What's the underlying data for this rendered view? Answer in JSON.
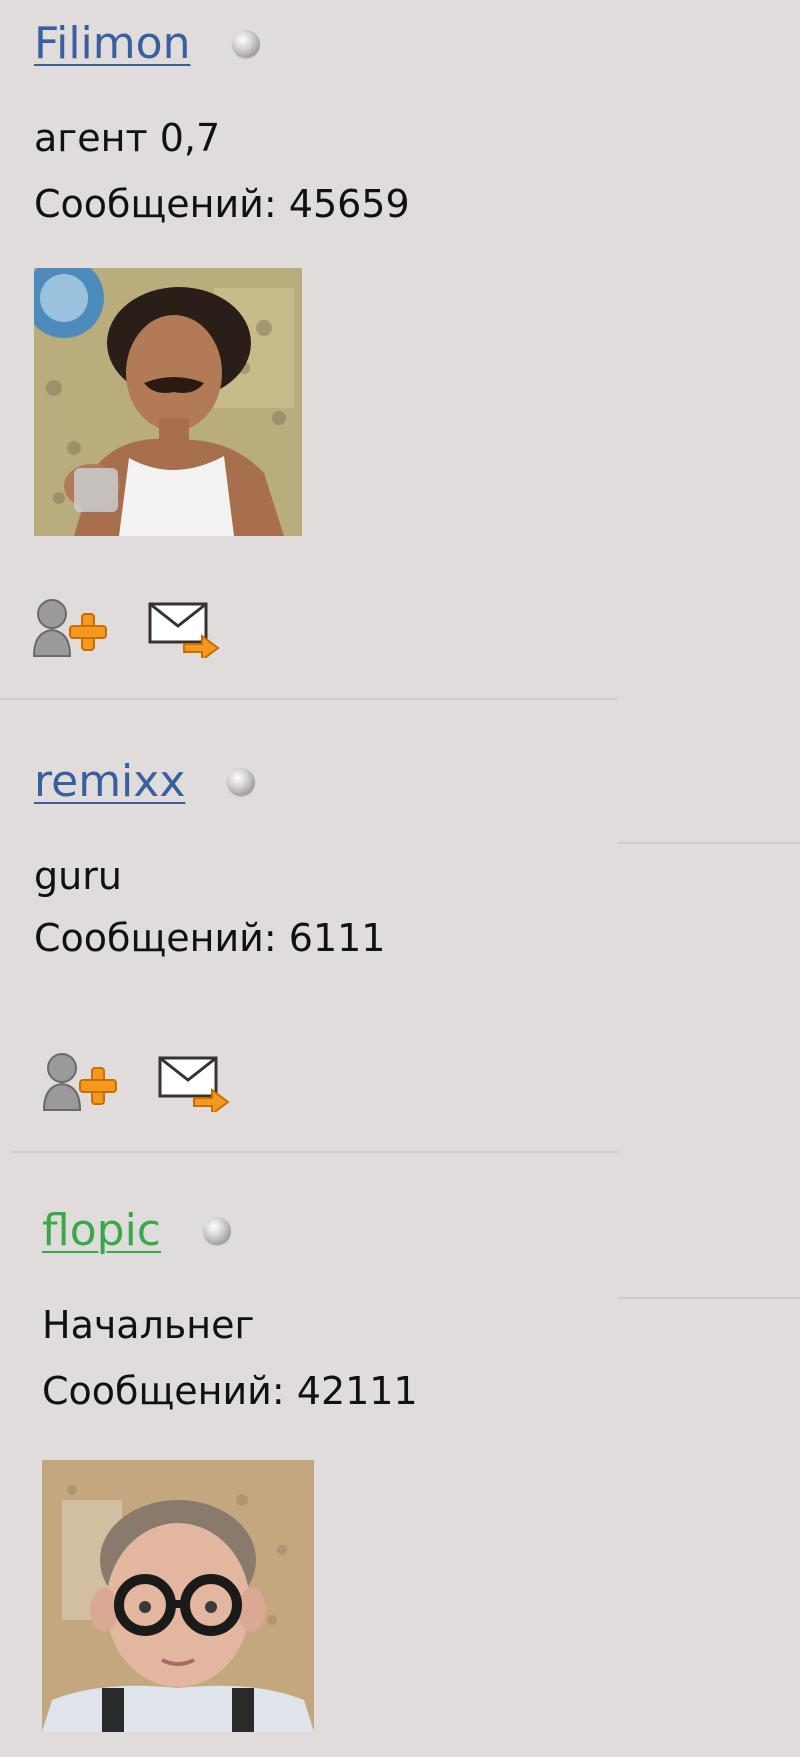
{
  "posts": [
    {
      "username": "Filimon",
      "username_color": "#3a5f9e",
      "status": "offline",
      "rank": "агент 0,7",
      "messages_label": "Сообщений:",
      "messages_count": "45659",
      "has_avatar": true,
      "actions": [
        "add-friend-icon",
        "send-message-icon"
      ]
    },
    {
      "username": "remixx",
      "username_color": "#3a5f9e",
      "status": "offline",
      "rank": "guru",
      "messages_label": "Сообщений:",
      "messages_count": "6111",
      "has_avatar": false,
      "actions": [
        "add-friend-icon",
        "send-message-icon"
      ]
    },
    {
      "username": "flopic",
      "username_color": "#3aa84a",
      "status": "offline",
      "rank": "Начальнег",
      "messages_label": "Сообщений:",
      "messages_count": "42111",
      "has_avatar": true,
      "actions": []
    }
  ]
}
